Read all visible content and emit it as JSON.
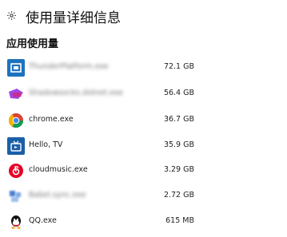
{
  "header": {
    "icon": "gear-icon",
    "title": "使用量详细信息"
  },
  "section": {
    "title": "应用使用量"
  },
  "apps": [
    {
      "icon": "thunder-platform-icon",
      "name": "ThunderPlatform.exe",
      "size": "72.1 GB",
      "blurred": true,
      "color": "#1e73be"
    },
    {
      "icon": "shadowsocks-icon",
      "name": "Shadowsocks.dotnet.exe",
      "size": "56.4 GB",
      "blurred": true,
      "color": "#7b3fa0"
    },
    {
      "icon": "chrome-icon",
      "name": "chrome.exe",
      "size": "36.7 GB",
      "blurred": false,
      "color": "#4285f4"
    },
    {
      "icon": "tv-icon",
      "name": "Hello, TV",
      "size": "35.9 GB",
      "blurred": false,
      "color": "#1b5fa8"
    },
    {
      "icon": "netease-music-icon",
      "name": "cloudmusic.exe",
      "size": "3.29 GB",
      "blurred": false,
      "color": "#e60026"
    },
    {
      "icon": "unknown-app-icon",
      "name": "Babel.sync.exe",
      "size": "2.72 GB",
      "blurred": true,
      "color": "#4a7fd0"
    },
    {
      "icon": "qq-icon",
      "name": "QQ.exe",
      "size": "615 MB",
      "blurred": false,
      "color": "#12b7f5"
    }
  ]
}
